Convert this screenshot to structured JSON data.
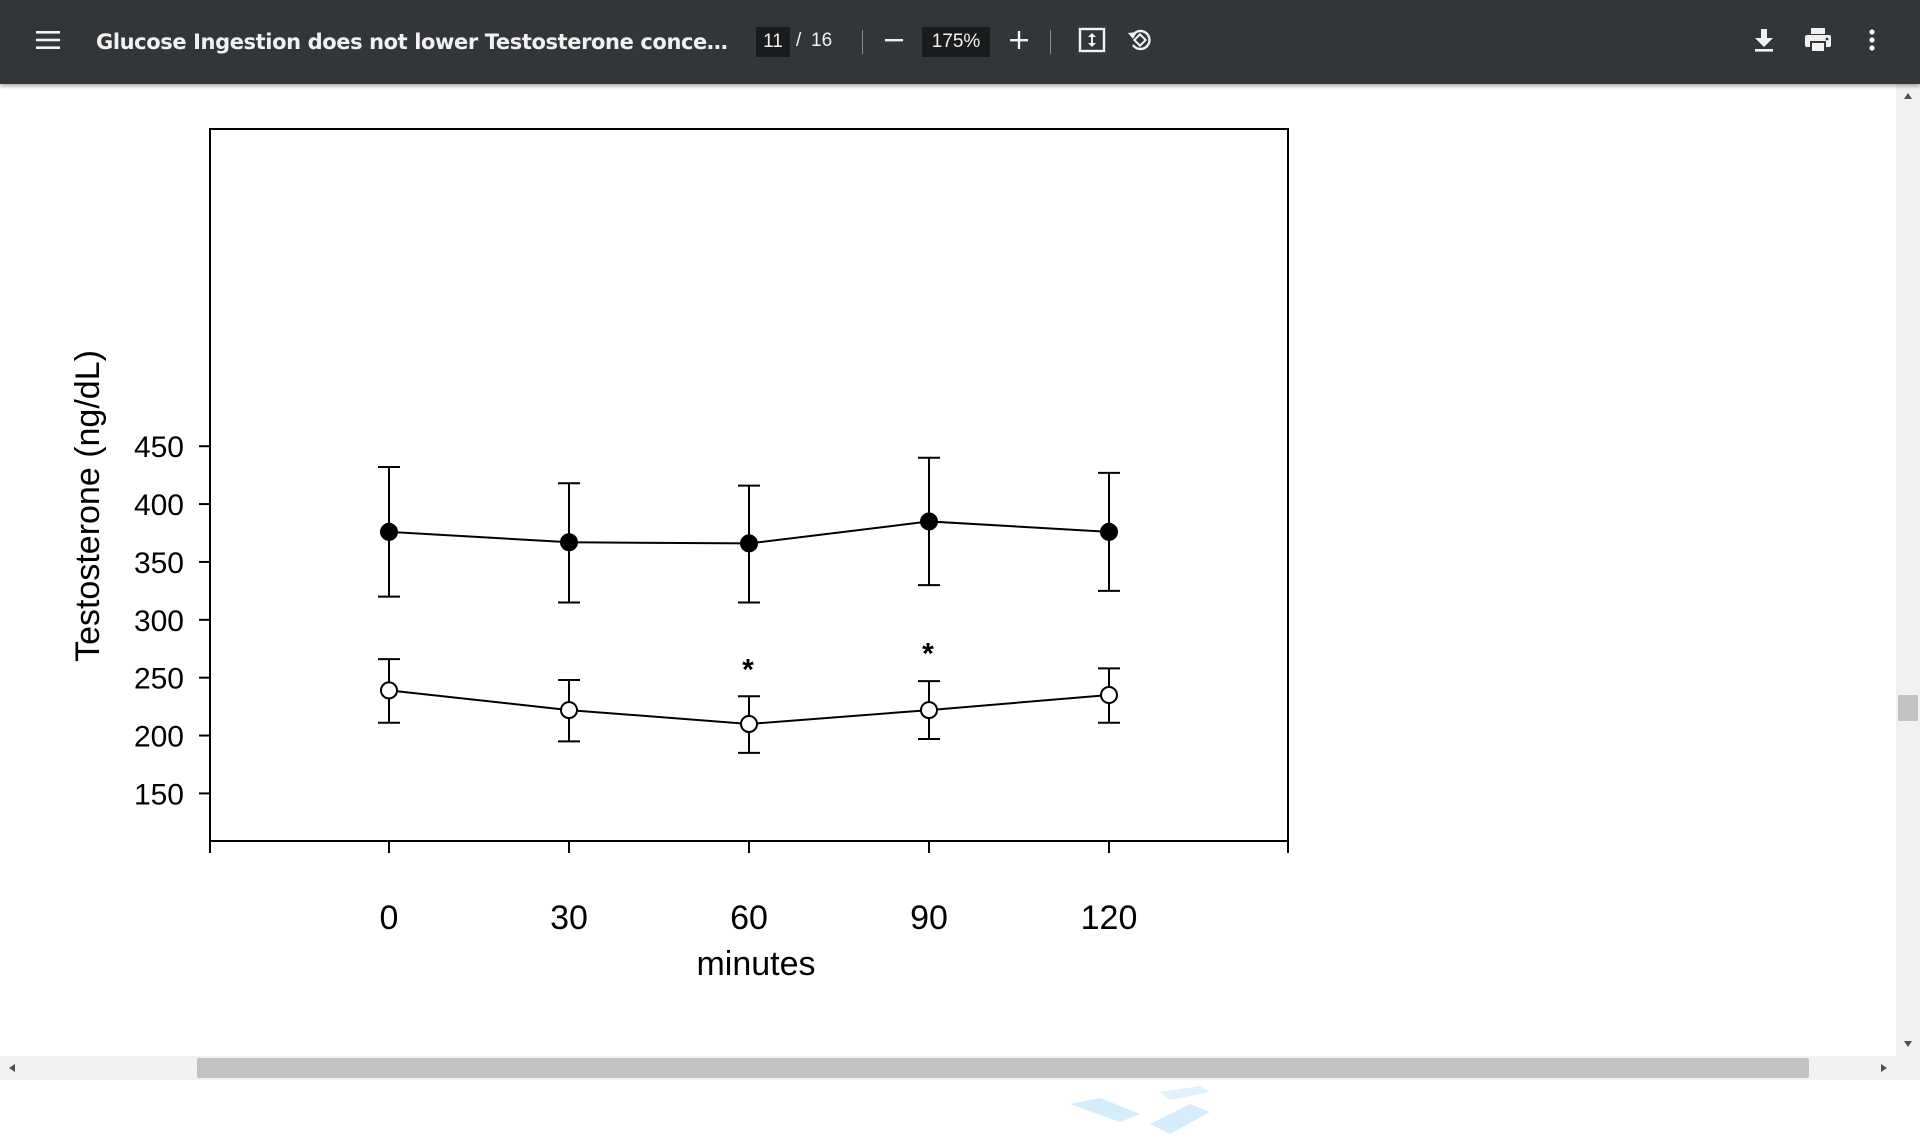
{
  "toolbar": {
    "menu_icon": "hamburger-menu-icon",
    "document_title": "Glucose Ingestion does not lower Testosterone concentrations in...",
    "current_page": "11",
    "page_separator": "/",
    "total_pages": "16",
    "zoom_level": "175%",
    "icons": [
      "minus-icon",
      "plus-icon",
      "fit-to-page-icon",
      "rotate-icon",
      "download-icon",
      "print-icon",
      "more-vert-icon"
    ]
  },
  "colors": {
    "toolbar_bg": "#323639",
    "toolbar_text": "#f1f1f1",
    "input_bg": "#191b1c",
    "page_bg": "#ffffff",
    "scrollbar_track": "#f1f1f1",
    "scrollbar_thumb": "#c1c1c1"
  },
  "chart_data": {
    "type": "line",
    "xlabel": "minutes",
    "ylabel": "Testosterone (ng/dL)",
    "x": [
      0,
      30,
      60,
      90,
      120
    ],
    "xticks": [
      "0",
      "30",
      "60",
      "90",
      "120"
    ],
    "xlim": [
      -30,
      150
    ],
    "ylim": [
      150,
      465
    ],
    "yticks": [
      "150",
      "200",
      "250",
      "300",
      "350",
      "400",
      "450"
    ],
    "series": [
      {
        "marker": "filled-circle",
        "values": [
          376,
          367,
          366,
          385,
          376
        ],
        "err_high": [
          432,
          418,
          416,
          440,
          427
        ],
        "err_low": [
          320,
          315,
          315,
          330,
          325
        ]
      },
      {
        "marker": "open-circle",
        "values": [
          239,
          222,
          210,
          222,
          235
        ],
        "err_high": [
          266,
          248,
          234,
          247,
          258
        ],
        "err_low": [
          211,
          195,
          185,
          197,
          211
        ]
      }
    ],
    "annotations": [
      {
        "text": "*",
        "x": 60,
        "y": 250
      },
      {
        "text": "*",
        "x": 90,
        "y": 264
      }
    ]
  }
}
